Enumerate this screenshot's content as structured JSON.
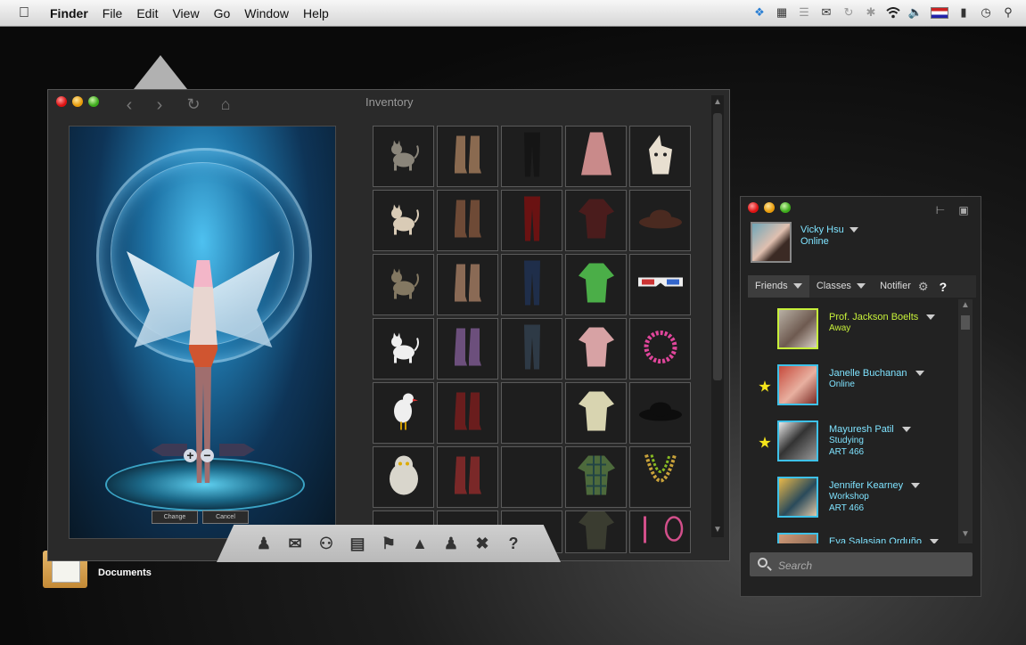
{
  "menubar": {
    "app_name": "Finder",
    "items": [
      "File",
      "Edit",
      "View",
      "Go",
      "Window",
      "Help"
    ],
    "status_icons": [
      "dropbox-icon",
      "calendar-icon",
      "bars-icon",
      "mail-icon",
      "time-machine-icon",
      "bluetooth-icon",
      "wifi-icon",
      "volume-icon",
      "flag-icon",
      "battery-icon",
      "clock-icon",
      "spotlight-icon"
    ]
  },
  "desktop": {
    "documents_label": "Documents"
  },
  "inventory": {
    "title": "Inventory",
    "preview_buttons": {
      "change": "Change",
      "cancel": "Cancel"
    },
    "zoom": {
      "in": "+",
      "out": "−"
    },
    "grid": [
      [
        "cat-grey",
        "boots-green",
        "pants-black",
        "dress-pink",
        "unicorn-mask"
      ],
      [
        "cat-calico",
        "boots-brown",
        "skirt-red",
        "top-dark-red",
        "hat-brown"
      ],
      [
        "cat-tabby",
        "boots-tan",
        "jeans-blue",
        "vest-green",
        "glasses-3d"
      ],
      [
        "cat-white",
        "boots-purple",
        "jeans-grey",
        "hoodie-pink",
        "necklace-pink"
      ],
      [
        "bird-white",
        "boots-red",
        "",
        "jacket-green",
        "hat-black"
      ],
      [
        "owl-snowy",
        "boots-red-lace",
        "",
        "shirt-plaid",
        "necklace-beads"
      ],
      [
        "",
        "",
        "",
        "jacket-dark",
        "earrings-pink"
      ]
    ],
    "dock": [
      "avatar-icon",
      "inventory-icon",
      "cart-icon",
      "clipboard-icon",
      "trophy-icon",
      "gamepad-icon",
      "friends-icon",
      "tools-icon",
      "help-icon"
    ],
    "dock_help": "?"
  },
  "friends_panel": {
    "me": {
      "name": "Vicky Hsu",
      "status": "Online"
    },
    "tabs": [
      "Friends",
      "Classes",
      "Notifier"
    ],
    "help": "?",
    "friends": [
      {
        "name": "Prof. Jackson Boelts",
        "status": "Away",
        "course": "",
        "favorite": false,
        "color": "#c7f03a"
      },
      {
        "name": "Janelle Buchanan",
        "status": "Online",
        "course": "",
        "favorite": true,
        "color": "#7fe3ff"
      },
      {
        "name": "Mayuresh Patil",
        "status": "Studying",
        "course": "ART 466",
        "favorite": true,
        "color": "#7fe3ff"
      },
      {
        "name": "Jennifer Kearney",
        "status": "Workshop",
        "course": "ART 466",
        "favorite": false,
        "color": "#7fe3ff"
      },
      {
        "name": "Eva Salasian Orduño",
        "status": "",
        "course": "",
        "favorite": false,
        "color": "#7fe3ff"
      }
    ],
    "search": {
      "placeholder": "Search",
      "value": ""
    }
  },
  "colors": {
    "accent": "#7fe3ff",
    "away": "#c7f03a",
    "favorite": "#f5e51b"
  }
}
